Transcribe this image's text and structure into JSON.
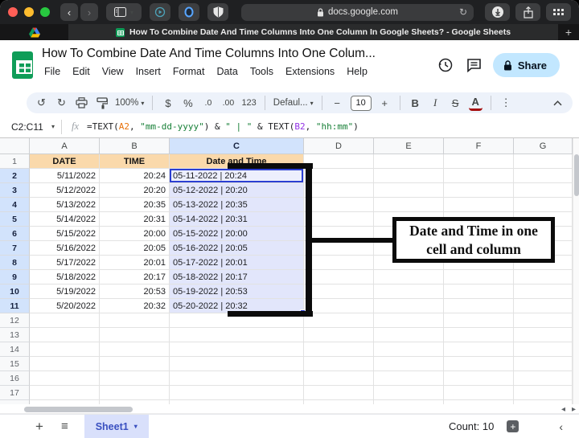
{
  "browser": {
    "url": "docs.google.com",
    "tab_title": "How To Combine Date And Time Columns Into One Column In Google Sheets? - Google Sheets",
    "new_tab_label": "+"
  },
  "header": {
    "doc_title": "How To Combine Date And Time Columns Into One Colum...",
    "menus": [
      "File",
      "Edit",
      "View",
      "Insert",
      "Format",
      "Data",
      "Tools",
      "Extensions",
      "Help"
    ],
    "share_label": "Share"
  },
  "toolbar": {
    "undo": "↺",
    "redo": "↻",
    "zoom": "100%",
    "currency": "$",
    "percent": "%",
    "decrease_decimal": ".0",
    "increase_decimal": ".00",
    "more_formats": "123",
    "font_family": "Defaul...",
    "font_size_minus": "−",
    "font_size": "10",
    "font_size_plus": "+",
    "bold": "B",
    "italic": "I",
    "strikethrough": "S",
    "text_color": "A",
    "more": "⋮"
  },
  "formula_bar": {
    "name_box": "C2:C11",
    "fx_label": "fx",
    "formula_parts": [
      {
        "t": "=TEXT(",
        "c": "default"
      },
      {
        "t": "A2",
        "c": "orange"
      },
      {
        "t": ", ",
        "c": "default"
      },
      {
        "t": "\"mm-dd-yyyy\"",
        "c": "green"
      },
      {
        "t": ") & ",
        "c": "default"
      },
      {
        "t": "\" | \"",
        "c": "green"
      },
      {
        "t": " & TEXT(",
        "c": "default"
      },
      {
        "t": "B2",
        "c": "purple"
      },
      {
        "t": ", ",
        "c": "default"
      },
      {
        "t": "\"hh:mm\"",
        "c": "green"
      },
      {
        "t": ")",
        "c": "default"
      }
    ]
  },
  "grid": {
    "column_letters": [
      "A",
      "B",
      "C",
      "D",
      "E",
      "F",
      "G"
    ],
    "selected_column": "C",
    "visible_row_count": 18,
    "selected_rows_start": 2,
    "selected_rows_end": 11,
    "row1_headers": {
      "A": "DATE",
      "B": "TIME",
      "C": "Date and Time"
    },
    "data_rows": [
      {
        "row": 2,
        "date": "5/11/2022",
        "time": "20:24",
        "combined": "05-11-2022 | 20:24"
      },
      {
        "row": 3,
        "date": "5/12/2022",
        "time": "20:20",
        "combined": "05-12-2022 | 20:20"
      },
      {
        "row": 4,
        "date": "5/13/2022",
        "time": "20:35",
        "combined": "05-13-2022 | 20:35"
      },
      {
        "row": 5,
        "date": "5/14/2022",
        "time": "20:31",
        "combined": "05-14-2022 | 20:31"
      },
      {
        "row": 6,
        "date": "5/15/2022",
        "time": "20:00",
        "combined": "05-15-2022 | 20:00"
      },
      {
        "row": 7,
        "date": "5/16/2022",
        "time": "20:05",
        "combined": "05-16-2022 | 20:05"
      },
      {
        "row": 8,
        "date": "5/17/2022",
        "time": "20:01",
        "combined": "05-17-2022 | 20:01"
      },
      {
        "row": 9,
        "date": "5/18/2022",
        "time": "20:17",
        "combined": "05-18-2022 | 20:17"
      },
      {
        "row": 10,
        "date": "5/19/2022",
        "time": "20:53",
        "combined": "05-19-2022 | 20:53"
      },
      {
        "row": 11,
        "date": "5/20/2022",
        "time": "20:32",
        "combined": "05-20-2022 | 20:32"
      }
    ]
  },
  "annotation": {
    "line1": "Date and Time in one",
    "line2": "cell and column"
  },
  "footer": {
    "sheet_tab": "Sheet1",
    "count_label": "Count: 10"
  },
  "colors": {
    "default": "#202124",
    "orange": "#e8710a",
    "green": "#188038",
    "purple": "#9334e6",
    "selection_accent": "#2b3ed2",
    "header_fill": "#fad9ab",
    "selected_header_fill": "#d2e3fc",
    "share_pill": "#c2e7ff",
    "sheets_green": "#0f9d58"
  }
}
